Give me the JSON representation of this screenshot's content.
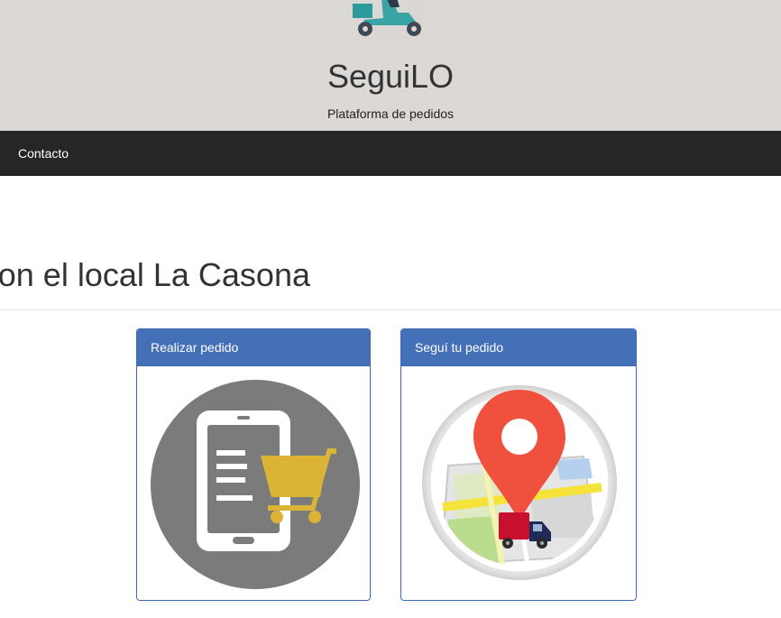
{
  "header": {
    "brand": "SeguiLO",
    "tagline": "Plataforma de pedidos",
    "logo_icon": "delivery-scooter-icon"
  },
  "navbar": {
    "items": [
      {
        "label": "Contacto"
      }
    ]
  },
  "main": {
    "welcome_text": "on el local La Casona"
  },
  "panels": [
    {
      "title": "Realizar pedido",
      "icon": "mobile-cart-icon"
    },
    {
      "title": "Seguí tu pedido",
      "icon": "map-tracking-icon"
    }
  ],
  "colors": {
    "header_bg": "#dcd8d6",
    "navbar_bg": "#262626",
    "panel_heading_bg": "#4470b8",
    "cart_yellow": "#dbb335",
    "pin_red": "#f0513f",
    "truck_red": "#c8102e"
  }
}
